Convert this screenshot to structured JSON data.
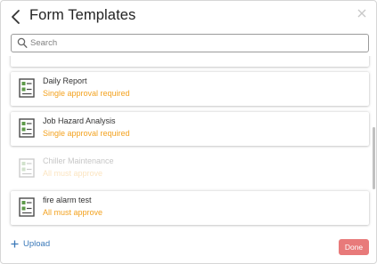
{
  "header": {
    "title": "Form Templates",
    "back_icon": "chevron-left-icon",
    "close_icon": "close-icon"
  },
  "search": {
    "placeholder": "Search",
    "value": "",
    "icon": "search-icon"
  },
  "templates": [
    {
      "name": "Daily Report",
      "approval": "Single approval required",
      "icon": "form-checklist-icon",
      "state": "normal"
    },
    {
      "name": "Job Hazard Analysis",
      "approval": "Single approval required",
      "icon": "form-checklist-icon",
      "state": "normal"
    },
    {
      "name": "Chiller Maintenance",
      "approval": "All must approve",
      "icon": "form-checklist-icon",
      "state": "faded"
    },
    {
      "name": "fire alarm test",
      "approval": "All must approve",
      "icon": "form-checklist-icon",
      "state": "normal"
    }
  ],
  "footer": {
    "upload_label": "Upload",
    "upload_icon": "plus-icon",
    "done_label": "Done"
  },
  "colors": {
    "approval_text": "#f3a21f",
    "upload_link": "#3a78b8",
    "done_button": "#e87a7a",
    "icon_green": "#5e9a4a"
  }
}
